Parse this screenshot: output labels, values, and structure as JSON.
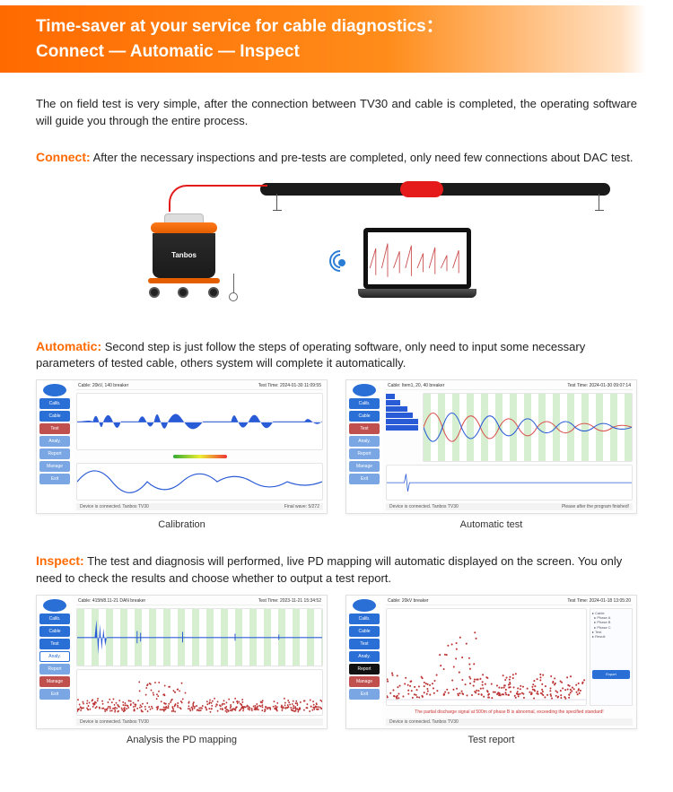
{
  "banner": {
    "line1": "Time-saver at your service for cable diagnostics：",
    "line2": "Connect — Automatic — Inspect"
  },
  "intro": "The on field test is very simple, after the connection between TV30 and cable is completed, the operating software will guide you through the entire process.",
  "steps": {
    "connect": {
      "label": "Connect:",
      "text": " After the necessary inspections and pre-tests are completed, only need few connections about DAC test."
    },
    "automatic": {
      "label": "Automatic:",
      "text": " Second step is just follow the steps of operating software, only need to input some necessary parameters of tested cable, others system will complete it automatically."
    },
    "inspect": {
      "label": "Inspect:",
      "text": " The test and diagnosis will performed, live PD mapping will automatic displayed on the screen. You only need to check the results and choose whether to output a test report."
    }
  },
  "diagram": {
    "device_brand": "Tanbos"
  },
  "sidebar": {
    "items": [
      "Calib.",
      "Cable",
      "Test",
      "Analy.",
      "Report",
      "Manage",
      "Exit"
    ]
  },
  "shots": {
    "calibration": {
      "caption": "Calibration",
      "topleft": "Cable: 20kV, 140 breaker",
      "topright": "Test Time: 2024-01-30 11:09:55",
      "footer_left": "Device is connected. Tanbos TV30",
      "footer_right": "Final wave: 5/272"
    },
    "autotest": {
      "caption": "Automatic test",
      "topleft": "Cable: Item1, 20, 40 breaker",
      "topright": "Test Time: 2024-01-30 09:07:14",
      "footer_left": "Device is connected. Tanbos TV30",
      "footer_right": "Please after the program finished!"
    },
    "pdmapping": {
      "caption": "Analysis the PD mapping",
      "topleft": "Cable: 415ft/8.11-21 DAN breaker",
      "topright": "Test Time: 2023-11-21 15:34:52",
      "footer_left": "Device is connected. Tanbos TV30"
    },
    "testreport": {
      "caption": "Test report",
      "topleft": "Cable: 20kV breaker",
      "topright": "Test Time: 2024-01-18 13:05:20",
      "warning": "The partial discharge signal at 500m of phase B is abnormal, exceeding the specified standard!",
      "footer_left": "Device is connected. Tanbos TV30"
    }
  }
}
